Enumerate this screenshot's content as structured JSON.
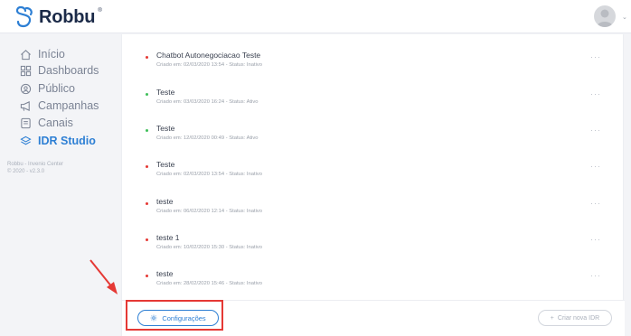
{
  "brand": {
    "name": "Robbu",
    "mark": "®"
  },
  "header": {
    "caret": "⌄"
  },
  "sidebar": {
    "items": [
      {
        "label": "Início",
        "icon": "home-icon"
      },
      {
        "label": "Dashboards",
        "icon": "grid-icon"
      },
      {
        "label": "Público",
        "icon": "audience-icon"
      },
      {
        "label": "Campanhas",
        "icon": "megaphone-icon"
      },
      {
        "label": "Canais",
        "icon": "chat-icon"
      },
      {
        "label": "IDR Studio",
        "icon": "layers-icon",
        "active": true
      }
    ],
    "meta_line1": "Robbu - Invenio Center",
    "meta_line2": "© 2020 - v2.3.0"
  },
  "list": {
    "items": [
      {
        "name": "Chatbot Autonegociacao Teste",
        "subtitle": "Criado em: 02/03/2020 13:54 - Status: Inativo",
        "status": "inativo"
      },
      {
        "name": "Teste",
        "subtitle": "Criado em: 03/03/2020 16:24 - Status: Ativo",
        "status": "ativo"
      },
      {
        "name": "Teste",
        "subtitle": "Criado em: 12/02/2020 00:49 - Status: Ativo",
        "status": "ativo"
      },
      {
        "name": "Teste",
        "subtitle": "Criado em: 02/03/2020 13:54 - Status: Inativo",
        "status": "inativo"
      },
      {
        "name": "teste",
        "subtitle": "Criado em: 06/02/2020 12:14 - Status: Inativo",
        "status": "inativo"
      },
      {
        "name": "teste 1",
        "subtitle": "Criado em: 10/02/2020 15:30 - Status: Inativo",
        "status": "inativo"
      },
      {
        "name": "teste",
        "subtitle": "Criado em: 28/02/2020 15:46 - Status: Inativo",
        "status": "inativo"
      }
    ],
    "menu_glyph": "···"
  },
  "footer": {
    "config_label": "Configurações",
    "new_label": "Criar nova IDR",
    "new_icon_glyph": "+"
  },
  "colors": {
    "accent": "#2d7fd4",
    "status_active": "#3fbf5a",
    "status_inactive": "#e53935",
    "annotation": "#e53935"
  }
}
